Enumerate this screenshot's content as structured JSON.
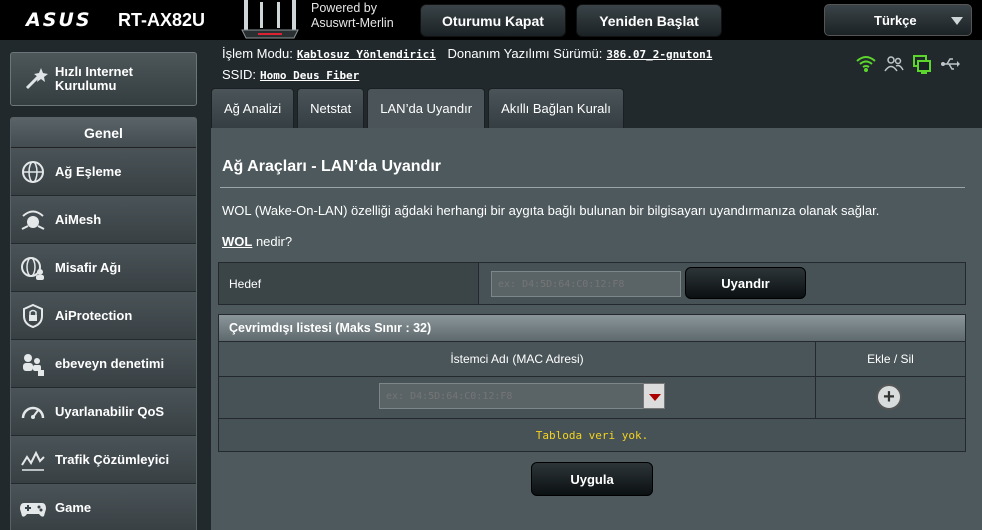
{
  "header": {
    "brand": "ASUS",
    "model": "RT-AX82U",
    "powered_line1": "Powered by",
    "powered_line2": "Asuswrt-Merlin",
    "logout_label": "Oturumu Kapat",
    "reboot_label": "Yeniden Başlat",
    "language": "Türkçe"
  },
  "sidebar": {
    "quick_setup_line1": "Hızlı Internet",
    "quick_setup_line2": "Kurulumu",
    "section_title": "Genel",
    "items": [
      {
        "label": "Ağ Eşleme",
        "icon": "network-map-icon"
      },
      {
        "label": "AiMesh",
        "icon": "aimesh-icon"
      },
      {
        "label": "Misafir Ağı",
        "icon": "guest-network-icon"
      },
      {
        "label": "AiProtection",
        "icon": "shield-icon"
      },
      {
        "label": "ebeveyn denetimi",
        "icon": "parental-control-icon"
      },
      {
        "label": "Uyarlanabilir QoS",
        "icon": "speedometer-icon"
      },
      {
        "label": "Trafik Çözümleyici",
        "icon": "traffic-analyzer-icon"
      },
      {
        "label": "Game",
        "icon": "gamepad-icon"
      }
    ]
  },
  "info": {
    "mode_label": "İşlem Modu:",
    "mode_value": "Kablosuz Yönlendirici",
    "firmware_label": "Donanım Yazılımı Sürümü:",
    "firmware_value": "386.07_2-gnuton1",
    "ssid_label": "SSID:",
    "ssid_value": "Homo Deus Fiber"
  },
  "status_icons": [
    "wifi-icon",
    "clients-icon",
    "lan-icon",
    "usb-icon"
  ],
  "tabs": [
    {
      "label": "Ağ Analizi",
      "active": false
    },
    {
      "label": "Netstat",
      "active": false
    },
    {
      "label": "LAN’da Uyandır",
      "active": true
    },
    {
      "label": "Akıllı Bağlan Kuralı",
      "active": false
    }
  ],
  "main": {
    "title": "Ağ Araçları - LAN’da Uyandır",
    "description": "WOL (Wake-On-LAN) özelliği ağdaki herhangi bir aygıta bağlı bulunan bir bilgisayarı uyandırmanıza olanak sağlar.",
    "wol_link": "WOL",
    "wol_suffix": " nedir?",
    "target_label": "Hedef",
    "target_placeholder": "ex: D4:5D:64:C0:12:F8",
    "wake_button": "Uyandır",
    "offline_list_title": "Çevrimdışı listesi (Maks Sınır : 32)",
    "col_client": "İstemci Adı (MAC Adresi)",
    "col_add_remove": "Ekle / Sil",
    "client_placeholder": "ex: D4:5D:64:C0:12:F8",
    "empty_text": "Tabloda veri yok.",
    "apply_button": "Uygula"
  },
  "colors": {
    "accent_green": "#5cd62c",
    "empty_text": "#f4d21f",
    "background": "#21292c",
    "panel": "#4d595d"
  }
}
